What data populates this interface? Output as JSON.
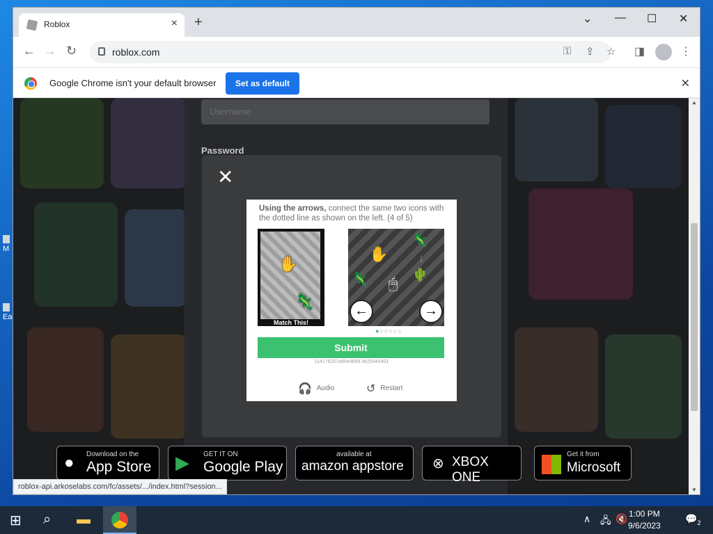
{
  "desktop": {
    "icons": [
      {
        "label": "M"
      },
      {
        "label": "Ea"
      }
    ]
  },
  "browser": {
    "tab_title": "Roblox",
    "new_tab": "+",
    "url": "roblox.com",
    "infobar_text": "Google Chrome isn't your default browser",
    "set_default_label": "Set as default",
    "status_url": "roblox-api.arkoselabs.com/fc/assets/.../index.html?session..."
  },
  "login": {
    "username_placeholder": "Username",
    "password_label": "Password"
  },
  "captcha": {
    "instruction_bold": "Using the arrows,",
    "instruction_rest": " connect the same two icons with the dotted line as shown on the left. (4 of 5)",
    "match_label": "Match This!",
    "submit_label": "Submit",
    "session_id": "114178267a96e4b99.9625943401",
    "audio_label": "Audio",
    "restart_label": "Restart",
    "progress": {
      "current": 1,
      "total": 6
    }
  },
  "stores": [
    {
      "small": "Download on the",
      "big": "App Store"
    },
    {
      "small": "GET IT ON",
      "big": "Google Play"
    },
    {
      "small": "available at",
      "big": "amazon appstore"
    },
    {
      "small": "",
      "big": "XBOX ONE"
    },
    {
      "small": "Get it from",
      "big": "Microsoft"
    }
  ],
  "taskbar": {
    "time": "1:00 PM",
    "date": "9/6/2023",
    "notifications": "2"
  }
}
